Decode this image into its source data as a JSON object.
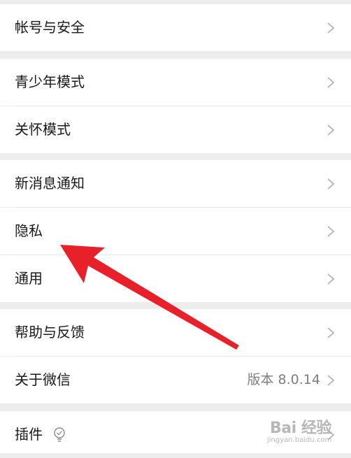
{
  "settings": {
    "items": [
      {
        "label": "帐号与安全"
      },
      {
        "label": "青少年模式"
      },
      {
        "label": "关怀模式"
      },
      {
        "label": "新消息通知"
      },
      {
        "label": "隐私"
      },
      {
        "label": "通用"
      },
      {
        "label": "帮助与反馈"
      },
      {
        "label": "关于微信",
        "value": "版本 8.0.14"
      },
      {
        "label": "插件"
      }
    ]
  },
  "icons": {
    "chevron": "chevron-right-icon",
    "plugin": "bulb-icon"
  },
  "colors": {
    "background": "#ededed",
    "cell": "#ffffff",
    "text": "#191919",
    "secondary_text": "#7d7d7d",
    "chevron": "#b2b2b2",
    "annotation_arrow": "#e8202a"
  },
  "watermark": {
    "main": "Bai 经验",
    "url": "jingyan.baidu.com"
  }
}
